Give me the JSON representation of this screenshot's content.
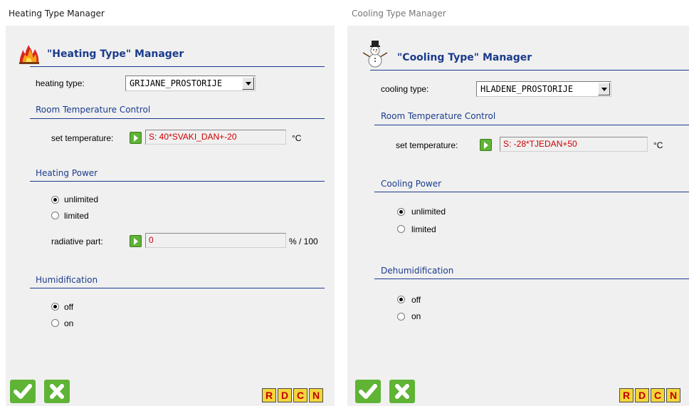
{
  "heating": {
    "window_title": "Heating Type Manager",
    "manager_title": "\"Heating Type\" Manager",
    "icon": "flame-icon",
    "type_label": "heating type:",
    "type_value": "GRIJANE_PROSTORIJE",
    "room_section": "Room Temperature Control",
    "set_temp_label": "set temperature:",
    "set_temp_value": "S: 40*SVAKI_DAN+-20",
    "temp_unit": "°C",
    "power_section": "Heating Power",
    "power_options": [
      {
        "label": "unlimited",
        "selected": true
      },
      {
        "label": "limited",
        "selected": false
      }
    ],
    "radiative_label": "radiative part:",
    "radiative_value": "0",
    "radiative_unit": "% / 100",
    "humid_section": "Humidification",
    "humid_options": [
      {
        "label": "off",
        "selected": true
      },
      {
        "label": "on",
        "selected": false
      }
    ]
  },
  "cooling": {
    "window_title": "Cooling Type Manager",
    "manager_title": "\"Cooling Type\" Manager",
    "icon": "snowman-icon",
    "type_label": "cooling type:",
    "type_value": "HLADENE_PROSTORIJE",
    "room_section": "Room Temperature Control",
    "set_temp_label": "set temperature:",
    "set_temp_value": "S: -28*TJEDAN+50",
    "temp_unit": "°C",
    "power_section": "Cooling Power",
    "power_options": [
      {
        "label": "unlimited",
        "selected": true
      },
      {
        "label": "limited",
        "selected": false
      }
    ],
    "dehumid_section": "Dehumidification",
    "dehumid_options": [
      {
        "label": "off",
        "selected": true
      },
      {
        "label": "on",
        "selected": false
      }
    ]
  },
  "toolbar": {
    "ok_icon": "checkmark-icon",
    "cancel_icon": "x-icon",
    "letter_buttons": [
      "R",
      "D",
      "C",
      "N"
    ]
  },
  "colors": {
    "accent": "#1a3b8c",
    "value_text": "#cc0000",
    "button_green": "#5fb335",
    "letter_button_bg": "#f3d63a",
    "letter_button_text": "#c00000",
    "panel_bg": "#f0f0f0"
  }
}
